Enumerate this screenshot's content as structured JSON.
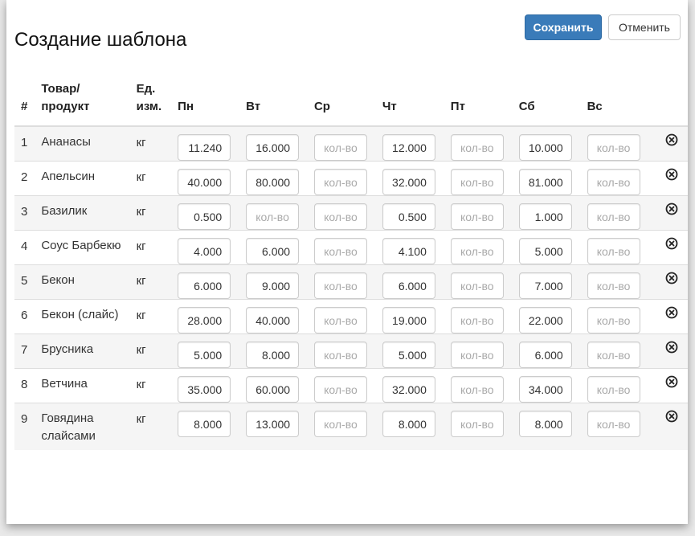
{
  "page": {
    "title": "Создание шаблона"
  },
  "actions": {
    "save_label": "Сохранить",
    "cancel_label": "Отменить"
  },
  "table": {
    "headers": {
      "num": "#",
      "product_line1": "Товар/",
      "product_line2": "продукт",
      "unit_line1": "Ед.",
      "unit_line2": "изм.",
      "days": [
        "Пн",
        "Вт",
        "Ср",
        "Чт",
        "Пт",
        "Сб",
        "Вс"
      ]
    },
    "placeholder": "кол-во",
    "rows": [
      {
        "num": "1",
        "product": "Ананасы",
        "unit": "кг",
        "values": [
          "11.240",
          "16.000",
          "",
          "12.000",
          "",
          "10.000",
          ""
        ]
      },
      {
        "num": "2",
        "product": "Апельсин",
        "unit": "кг",
        "values": [
          "40.000",
          "80.000",
          "",
          "32.000",
          "",
          "81.000",
          ""
        ]
      },
      {
        "num": "3",
        "product": "Базилик",
        "unit": "кг",
        "values": [
          "0.500",
          "",
          "",
          "0.500",
          "",
          "1.000",
          ""
        ]
      },
      {
        "num": "4",
        "product": "Соус Барбекю",
        "unit": "кг",
        "values": [
          "4.000",
          "6.000",
          "",
          "4.100",
          "",
          "5.000",
          ""
        ]
      },
      {
        "num": "5",
        "product": "Бекон",
        "unit": "кг",
        "values": [
          "6.000",
          "9.000",
          "",
          "6.000",
          "",
          "7.000",
          ""
        ]
      },
      {
        "num": "6",
        "product": "Бекон (слайс)",
        "unit": "кг",
        "values": [
          "28.000",
          "40.000",
          "",
          "19.000",
          "",
          "22.000",
          ""
        ]
      },
      {
        "num": "7",
        "product": "Брусника",
        "unit": "кг",
        "values": [
          "5.000",
          "8.000",
          "",
          "5.000",
          "",
          "6.000",
          ""
        ]
      },
      {
        "num": "8",
        "product": "Ветчина",
        "unit": "кг",
        "values": [
          "35.000",
          "60.000",
          "",
          "32.000",
          "",
          "34.000",
          ""
        ]
      },
      {
        "num": "9",
        "product": "Говядина слайсами",
        "unit": "кг",
        "values": [
          "8.000",
          "13.000",
          "",
          "8.000",
          "",
          "8.000",
          ""
        ]
      }
    ],
    "delete_icon": "remove-circle-icon"
  }
}
